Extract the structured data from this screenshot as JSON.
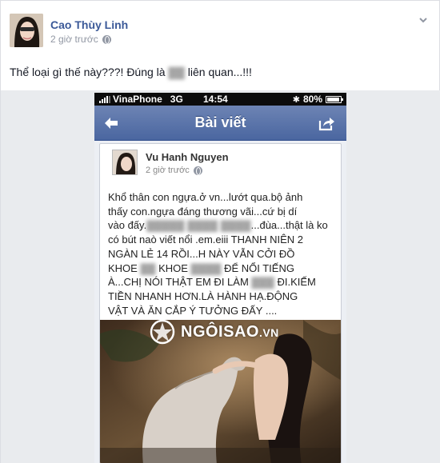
{
  "post": {
    "author": "Cao Thùy Linh",
    "timestamp": "2 giờ trước",
    "caption_before": "Thể loại gì thế này???! Đúng là ",
    "caption_blurred": "▓▓",
    "caption_after": " liên quan...!!!",
    "icons": {
      "globe": "globe-icon",
      "menu": "chevron-down-icon"
    }
  },
  "phone": {
    "carrier": "VinaPhone",
    "network": "3G",
    "time": "14:54",
    "battery": "80%",
    "title": "Bài viết",
    "shared_post": {
      "author": "Vu Hanh Nguyen",
      "timestamp": "2 giờ trước",
      "lines": [
        "Khổ thân con ngựa.ở vn...lướt qua.bộ ảnh",
        "thấy con.ngựa đáng thương vãi...cứ bị dí",
        "vào đấy.",
        "có bút naò viết nổi .em.eiii THANH NIÊN 2",
        "NGÀN LẺ 14 RỒI...H NÀY VẪN CỞI ĐỒ",
        "KHOE",
        "À...CHỊ NÓI THẬT EM ĐI LÀM",
        "TIỀN NHANH HƠN.LÀ HÀNH HẠ.ĐỘNG",
        "VẬT VÀ ĂN CẮP Ý TƯỞNG ĐẤY ...."
      ],
      "line3_tail": "...đùa...thật là ko",
      "line6_mid": "KHOE",
      "line6_tail": "ĐỂ NỔI TIẾNG",
      "line7_tail": "ĐI.KIẾM"
    }
  },
  "watermark": {
    "text": "NGÔISAO",
    "suffix": ".VN"
  }
}
